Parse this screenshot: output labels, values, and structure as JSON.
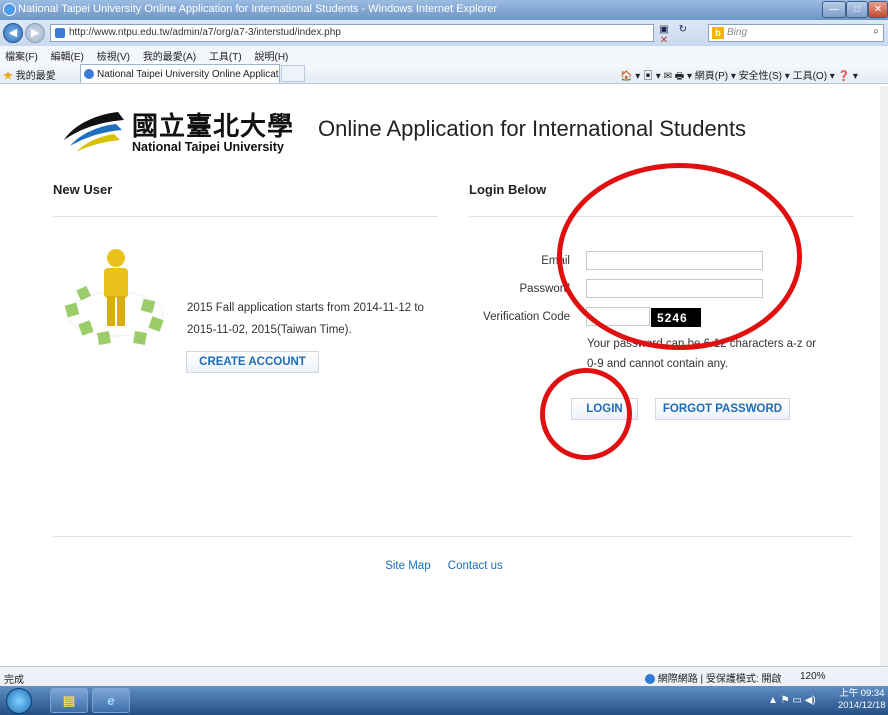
{
  "window": {
    "title": "National Taipei University Online Application for International Students - Windows Internet Explorer",
    "min_glyph": "—",
    "max_glyph": "□",
    "close_glyph": "✕"
  },
  "address_bar": {
    "back_glyph": "◀",
    "forward_glyph": "▶",
    "url": "http://www.ntpu.edu.tw/admin/a7/org/a7-3/interstud/index.php",
    "compat_glyph": "▣",
    "refresh_glyph": "↻",
    "stop_glyph": "✕",
    "search_placeholder": "Bing",
    "bing_glyph": "b",
    "search_glyph": "⌕"
  },
  "menu": [
    "檔案(F)",
    "編輯(E)",
    "檢視(V)",
    "我的最愛(A)",
    "工具(T)",
    "說明(H)"
  ],
  "favorites_bar": {
    "favorites_label": "我的最愛",
    "star_glyph": "★",
    "tab_title": "National Taipei University Online Application f...",
    "commands": "🏠 ▾  ▣ ▾  ✉  🖶 ▾  網頁(P) ▾  安全性(S) ▾  工具(O) ▾  ❓ ▾"
  },
  "header": {
    "university_cn": "國立臺北大學",
    "university_en": "National Taipei University",
    "site_title": "Online Application for International Students"
  },
  "new_user": {
    "heading": "New User",
    "intro": "2015 Fall application starts from 2014-11-12 to 2015-11-02, 2015(Taiwan Time).",
    "create_button": "CREATE ACCOUNT"
  },
  "login": {
    "heading": "Login Below",
    "email_label": "Email",
    "password_label": "Password",
    "verification_label": "Verification Code",
    "captcha": "5246",
    "password_hint": "Your password can be 6-12 characters a-z or 0-9 and cannot contain any.",
    "login_button": "LOGIN",
    "forgot_button": "FORGOT PASSWORD"
  },
  "footer": {
    "site_map": "Site Map",
    "contact": "Contact us"
  },
  "status_bar": {
    "status": "完成",
    "zone": "網際網路 | 受保護模式: 開啟",
    "zoom": "120%"
  },
  "taskbar": {
    "explorer_glyph": "▤",
    "ie_glyph": "e",
    "tray": "▲  ⚑  ▭  ◀)",
    "time": "上午 09:34",
    "date": "2014/12/18"
  },
  "colors": {
    "link_blue": "#1c6cb8",
    "annotation_red": "#e01010"
  }
}
